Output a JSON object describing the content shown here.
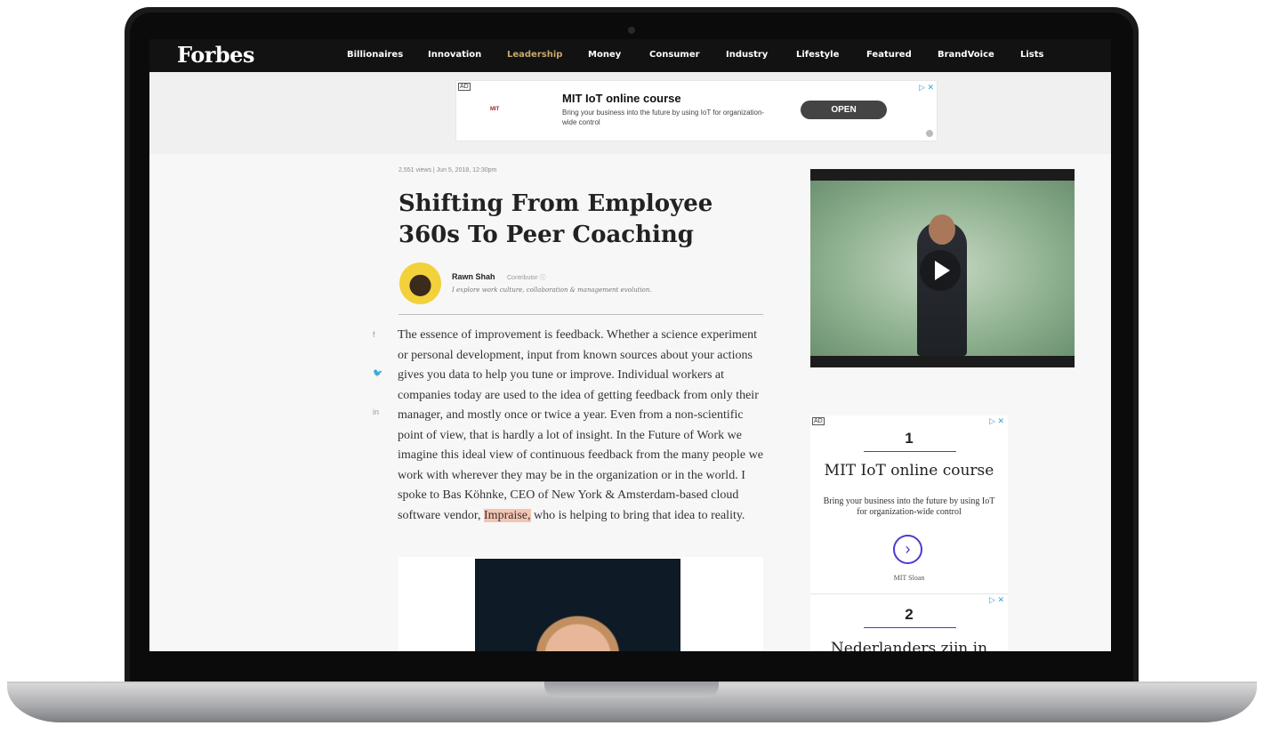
{
  "nav": {
    "logo": "Forbes",
    "items": [
      "Billionaires",
      "Innovation",
      "Leadership",
      "Money",
      "Consumer",
      "Industry",
      "Lifestyle",
      "Featured",
      "BrandVoice",
      "Lists"
    ],
    "active": "Leadership"
  },
  "top_ad": {
    "badge": "AD",
    "brand": "MIT",
    "title": "MIT IoT online course",
    "description": "Bring your business into the future by using IoT for organization-wide control",
    "cta": "OPEN",
    "close": "▷ ✕"
  },
  "article": {
    "meta": "2,551 views | Jun 5, 2018, 12:30pm",
    "headline": "Shifting From Employee 360s To Peer Coaching",
    "author": {
      "name": "Rawn Shah",
      "role": "Contributor ⓘ",
      "bio": "I explore work culture, collaboration & management evolution."
    },
    "share_icons": [
      "f",
      "🐦",
      "in"
    ],
    "body_before": "The essence of improvement is feedback. Whether a science experiment or personal development, input from known sources about your actions gives you data to help you tune or improve. Individual workers at companies today are used to the idea of getting feedback from only their manager, and mostly once or twice a year. Even from a non-scientific point of view, that is hardly a lot of insight. In the Future of Work we imagine this ideal view of continuous feedback from the many people we work with wherever they may be in the organization or in the world. I spoke to Bas Köhnke, CEO of New York & Amsterdam-based cloud software vendor, ",
    "body_link": "Impraise,",
    "body_after": " who is helping to bring that idea to reality."
  },
  "side_ad": {
    "badge": "AD",
    "close": "▷ ✕",
    "number_1": "1",
    "title": "MIT IoT online course",
    "description": "Bring your business into the future by using IoT for organization-wide control",
    "arrow": "›",
    "brand": "MIT Sloan",
    "number_2": "2",
    "next_title": "Nederlanders zijn in"
  }
}
